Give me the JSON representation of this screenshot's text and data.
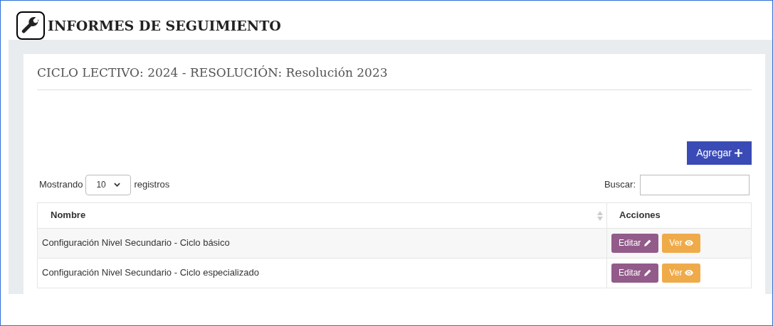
{
  "page_title": "INFORMES DE SEGUIMIENTO",
  "card_title": "CICLO LECTIVO: 2024 - RESOLUCIÓN: Resolución 2023",
  "add_button": "Agregar",
  "length_menu": {
    "before": "Mostrando",
    "value": "10",
    "after": "registros"
  },
  "search": {
    "label": "Buscar:"
  },
  "table": {
    "columns": [
      "Nombre",
      "Acciones"
    ],
    "rows": [
      {
        "name": "Configuración Nivel Secundario - Ciclo básico",
        "actions": [
          "Editar",
          "Ver"
        ]
      },
      {
        "name": "Configuración Nivel Secundario - Ciclo especializado",
        "actions": [
          "Editar",
          "Ver"
        ]
      }
    ]
  }
}
